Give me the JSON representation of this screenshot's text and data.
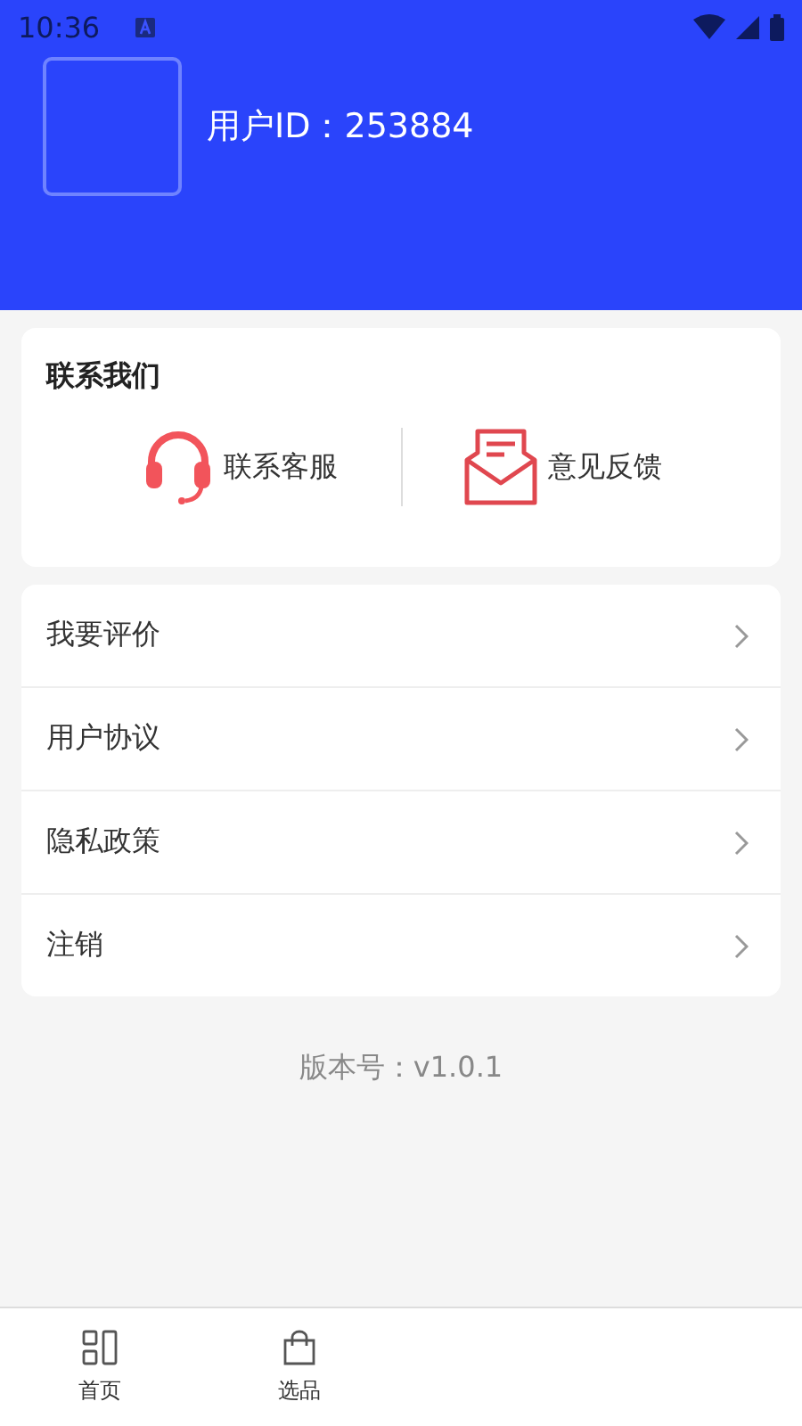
{
  "status_bar": {
    "time": "10:36"
  },
  "profile": {
    "user_id": "用户ID：253884"
  },
  "contact": {
    "title": "联系我们",
    "actions": [
      {
        "kind": "headset",
        "label": "联系客服"
      },
      {
        "kind": "mail",
        "label": "意见反馈"
      }
    ]
  },
  "menu": [
    {
      "label": "我要评价"
    },
    {
      "label": "用户协议"
    },
    {
      "label": "隐私政策"
    },
    {
      "label": "注销"
    }
  ],
  "version": "版本号：v1.0.1",
  "bottom_nav": [
    {
      "kind": "grid",
      "label": "首页"
    },
    {
      "kind": "bag",
      "label": "选品"
    }
  ]
}
